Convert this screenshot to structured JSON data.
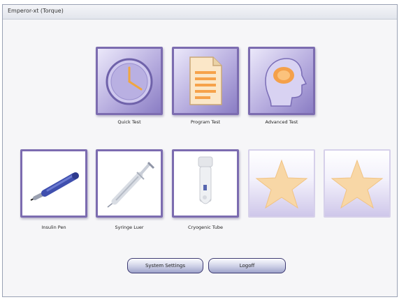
{
  "window": {
    "title": "Emperor-xt (Torque)"
  },
  "tiles": {
    "quick_test": {
      "label": "Quick Test",
      "icon": "clock-icon"
    },
    "program_test": {
      "label": "Program Test",
      "icon": "document-icon"
    },
    "advanced_test": {
      "label": "Advanced Test",
      "icon": "head-profile-icon"
    },
    "insulin_pen": {
      "label": "Insulin Pen",
      "icon": "insulin-pen-icon"
    },
    "syringe_luer": {
      "label": "Syringe Luer",
      "icon": "syringe-icon"
    },
    "cryogenic_tube": {
      "label": "Cryogenic Tube",
      "icon": "cryogenic-tube-icon"
    },
    "custom_1": {
      "label": "",
      "icon": "star-icon"
    },
    "custom_2": {
      "label": "",
      "icon": "star-icon"
    }
  },
  "buttons": {
    "system_settings": "System Settings",
    "logoff": "Logoff"
  },
  "colors": {
    "tile_border": "#7c6cb0",
    "tile_gradient_dark": "#8a7dc4",
    "star_fill": "#f8d7a6"
  }
}
